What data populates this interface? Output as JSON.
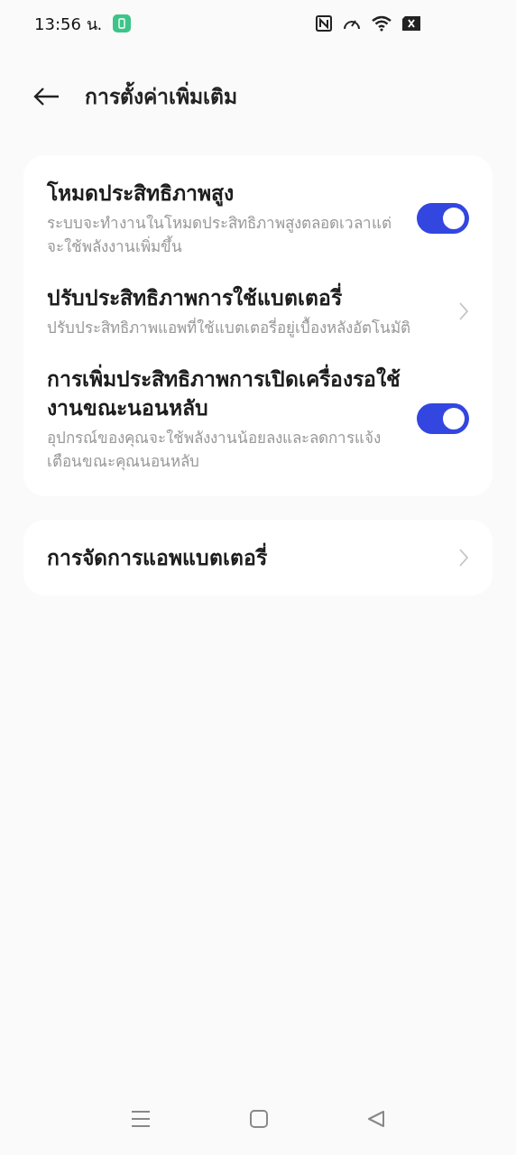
{
  "status_bar": {
    "time": "13:56 น."
  },
  "header": {
    "title": "การตั้งค่าเพิ่มเติม"
  },
  "groups": [
    {
      "items": [
        {
          "kind": "toggle",
          "title": "โหมดประสิทธิภาพสูง",
          "description": "ระบบจะทำงานในโหมดประสิทธิภาพสูงตลอดเวลาแต่จะใช้พลังงานเพิ่มขึ้น",
          "on": true
        },
        {
          "kind": "link",
          "title": "ปรับประสิทธิภาพการใช้แบตเตอรี่",
          "description": "ปรับประสิทธิภาพแอพที่ใช้แบตเตอรี่อยู่เบื้องหลังอัตโนมัติ"
        },
        {
          "kind": "toggle",
          "title": "การเพิ่มประสิทธิภาพการเปิดเครื่องรอใช้งานขณะนอนหลับ",
          "description": "อุปกรณ์ของคุณจะใช้พลังงานน้อยลงและลดการแจ้งเตือนขณะคุณนอนหลับ",
          "on": true
        }
      ]
    },
    {
      "items": [
        {
          "kind": "link",
          "title": "การจัดการแอพแบตเตอรี่"
        }
      ]
    }
  ]
}
